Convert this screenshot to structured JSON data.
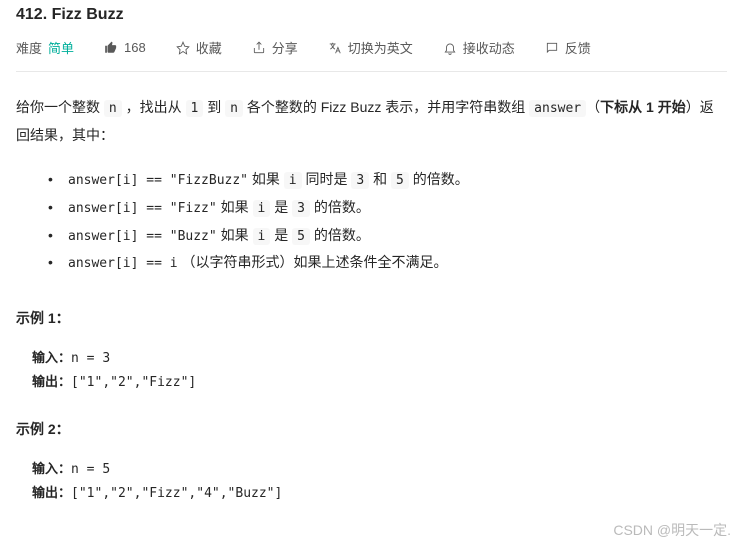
{
  "title": "412. Fizz Buzz",
  "meta": {
    "difficulty_label": "难度",
    "difficulty_value": "简单",
    "likes": "168",
    "favorite": "收藏",
    "share": "分享",
    "switch_lang": "切换为英文",
    "subscribe": "接收动态",
    "feedback": "反馈"
  },
  "desc": {
    "pre1": "给你一个整数 ",
    "code_n": "n",
    "mid1": " ，找出从 ",
    "code_1": "1",
    "mid2": " 到 ",
    "code_n2": "n",
    "mid3": " 各个整数的 Fizz Buzz 表示，并用字符串数组 ",
    "code_answer": "answer",
    "mid4": "（",
    "bold_index": "下标从 1 开始",
    "mid5": "）返回结果，其中："
  },
  "bullets": [
    {
      "code": "answer[i] == \"FizzBuzz\"",
      "text": " 如果 ",
      "code2": "i",
      "text2": " 同时是 ",
      "code3": "3",
      "text3": " 和 ",
      "code4": "5",
      "text4": " 的倍数。"
    },
    {
      "code": "answer[i] == \"Fizz\"",
      "text": " 如果 ",
      "code2": "i",
      "text2": " 是 ",
      "code3": "3",
      "text3": " 的倍数。",
      "code4": "",
      "text4": ""
    },
    {
      "code": "answer[i] == \"Buzz\"",
      "text": " 如果 ",
      "code2": "i",
      "text2": " 是 ",
      "code3": "5",
      "text3": " 的倍数。",
      "code4": "",
      "text4": ""
    },
    {
      "code": "answer[i] == i",
      "text": " （以字符串形式）如果上述条件全不满足。",
      "code2": "",
      "text2": "",
      "code3": "",
      "text3": "",
      "code4": "",
      "text4": ""
    }
  ],
  "examples": [
    {
      "title": "示例 1：",
      "input_label": "输入：",
      "input_val": "n = 3",
      "output_label": "输出：",
      "output_val": "[\"1\",\"2\",\"Fizz\"]"
    },
    {
      "title": "示例 2：",
      "input_label": "输入：",
      "input_val": "n = 5",
      "output_label": "输出：",
      "output_val": "[\"1\",\"2\",\"Fizz\",\"4\",\"Buzz\"]"
    }
  ],
  "watermark": "CSDN @明天一定."
}
